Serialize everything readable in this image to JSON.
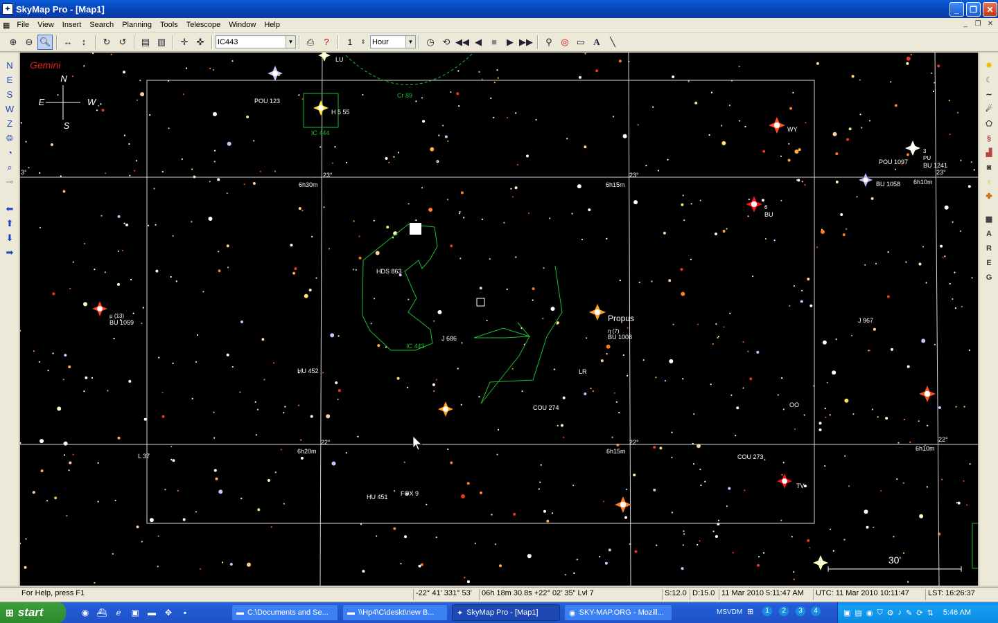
{
  "window": {
    "title": "SkyMap Pro - [Map1]",
    "app_icon": "skymap-icon",
    "controls": [
      "minimize",
      "restore",
      "close"
    ]
  },
  "menu": {
    "items": [
      "File",
      "View",
      "Insert",
      "Search",
      "Planning",
      "Tools",
      "Telescope",
      "Window",
      "Help"
    ]
  },
  "toolbar": {
    "object_value": "IC443",
    "step_value": "1",
    "step_unit": "Hour"
  },
  "left_toolbar": {
    "direction_buttons": [
      "N",
      "E",
      "S",
      "W",
      "Z"
    ]
  },
  "right_toolbar": {
    "letter_buttons": [
      "A",
      "R",
      "E",
      "G"
    ]
  },
  "map": {
    "constellation": "Gemini",
    "compass": {
      "n": "N",
      "e": "E",
      "w": "W",
      "s": "S"
    },
    "scale_label": "30'",
    "grid_labels": {
      "ra_6h30m": "6h30m",
      "ra_6h15m_top": "6h15m",
      "ra_6h10m_top": "6h10m",
      "ra_6h20m": "6h20m",
      "ra_6h15m_bottom": "6h15m",
      "ra_6h10m_bottom": "6h10m",
      "dec_23_left": "3°",
      "dec_23_mid": "23°",
      "dec_23_right": "23°",
      "dec_23_far": "23°",
      "dec_22_left": "22°",
      "dec_22_mid": "22°",
      "dec_22_right": "22°"
    },
    "labels": {
      "lu": "LU",
      "cr89": "Cr 89",
      "pou123": "POU 123",
      "h555": "H 5 55",
      "ic444": "IC 444",
      "wy": "WY",
      "pou1097": "POU 1097",
      "pu3": "3",
      "pu": "PU",
      "bu1241": "BU 1241",
      "bu1058": "BU 1058",
      "six": "6",
      "bu": "BU",
      "hds863": "HDS 863",
      "mu13": "μ (13)",
      "bu1059": "BU 1059",
      "ic443": "IC 443",
      "j686": "J 686",
      "propus": "Propus",
      "eta7": "η (7)",
      "bu1008": "BU 1008",
      "j967": "J 967",
      "hu452": "HU 452",
      "lr": "LR",
      "cou274": "COU 274",
      "oo": "OO",
      "l37": "L 37",
      "cou273": "COU 273",
      "tv": "TV",
      "hu451": "HU 451",
      "fox9": "FOX 9",
      "six_small": "6"
    }
  },
  "status": {
    "help": "For Help, press F1",
    "altaz": "-22° 41'  331° 53'",
    "radec": "06h 18m 30.8s  +22° 02' 35\"  Lvl 7",
    "s": "S:12.0",
    "d": "D:15.0",
    "local_time": "11 Mar 2010 5:11:47 AM",
    "utc": "UTC: 11 Mar 2010 10:11:47",
    "lst": "LST: 16:26:37"
  },
  "taskbar": {
    "start": "start",
    "tasks": [
      {
        "label": "C:\\Documents and Se...",
        "icon": "folder-icon"
      },
      {
        "label": "\\\\Hp4\\C\\deskt\\new B...",
        "icon": "folder-icon"
      },
      {
        "label": "SkyMap Pro - [Map1]",
        "icon": "skymap-icon"
      },
      {
        "label": "SKY-MAP.ORG - Mozill...",
        "icon": "firefox-icon"
      }
    ],
    "msvdm": "MSVDM",
    "desktops": [
      "1",
      "2",
      "3",
      "4"
    ],
    "clock": "5:46 AM"
  }
}
